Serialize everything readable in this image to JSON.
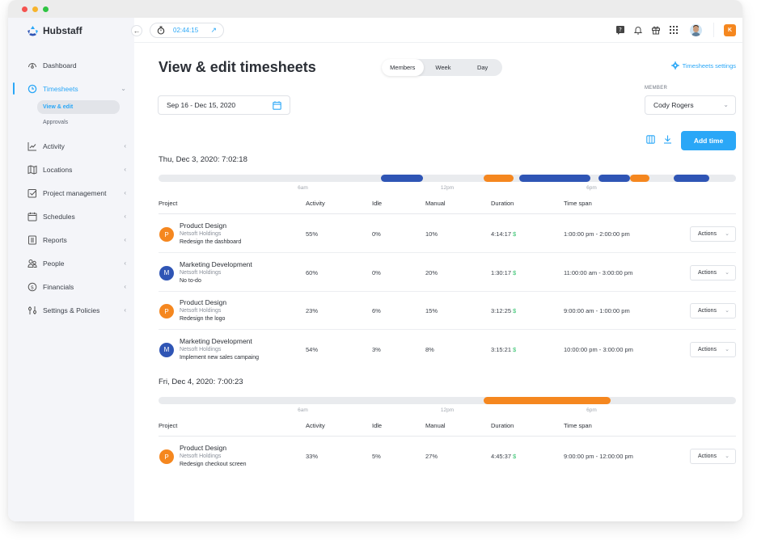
{
  "app": {
    "name": "Hubstaff",
    "timer": "02:44:15",
    "org_badge": "K"
  },
  "sidebar": {
    "items": [
      {
        "label": "Dashboard",
        "icon": "dashboard-icon"
      },
      {
        "label": "Timesheets",
        "icon": "clock-icon",
        "active": true,
        "expanded": true,
        "children": [
          {
            "label": "View & edit",
            "active": true
          },
          {
            "label": "Approvals"
          }
        ]
      },
      {
        "label": "Activity",
        "icon": "chart-icon"
      },
      {
        "label": "Locations",
        "icon": "map-icon"
      },
      {
        "label": "Project management",
        "icon": "checkbox-icon"
      },
      {
        "label": "Schedules",
        "icon": "calendar-icon"
      },
      {
        "label": "Reports",
        "icon": "report-icon"
      },
      {
        "label": "People",
        "icon": "people-icon"
      },
      {
        "label": "Financials",
        "icon": "dollar-icon"
      },
      {
        "label": "Settings & Policies",
        "icon": "sliders-icon"
      }
    ]
  },
  "header": {
    "title": "View & edit timesheets",
    "view_tabs": [
      {
        "label": "Members",
        "active": true
      },
      {
        "label": "Week"
      },
      {
        "label": "Day"
      }
    ],
    "settings_link": "Timesheets settings",
    "date_range": "Sep 16 - Dec 15, 2020",
    "member_label": "MEMBER",
    "member_value": "Cody Rogers",
    "add_time_label": "Add time"
  },
  "columns": [
    "Project",
    "Activity",
    "Idle",
    "Manual",
    "Duration",
    "Time span"
  ],
  "colors": {
    "accent": "#2aa7f7",
    "blue_segment": "#2f55b5",
    "orange_segment": "#f5871f",
    "money": "#31c26c"
  },
  "days": [
    {
      "title": "Thu, Dec 3, 2020:  7:02:18",
      "ticks": [
        "6am",
        "12pm",
        "6pm"
      ],
      "timeline_hours": [
        0,
        24
      ],
      "segments": [
        {
          "start": 9.25,
          "end": 11.0,
          "type": "blue"
        },
        {
          "start": 13.5,
          "end": 14.75,
          "type": "orange"
        },
        {
          "start": 15.0,
          "end": 17.95,
          "type": "blue"
        },
        {
          "start": 18.3,
          "end": 19.6,
          "type": "blue"
        },
        {
          "start": 19.6,
          "end": 20.4,
          "type": "orange"
        },
        {
          "start": 21.4,
          "end": 22.9,
          "type": "blue"
        }
      ],
      "rows": [
        {
          "initial": "P",
          "color": "orange",
          "project": "Product Design",
          "org": "Netsoft Holdings",
          "task": "Redesign the dashboard",
          "activity": "55%",
          "idle": "0%",
          "manual": "10%",
          "duration": "4:14:17",
          "money": "$",
          "span": "1:00:00 pm - 2:00:00 pm",
          "action": "Actions"
        },
        {
          "initial": "M",
          "color": "blue",
          "project": "Marketing Development",
          "org": "Netsoft Holdings",
          "task": "No to-do",
          "activity": "60%",
          "idle": "0%",
          "manual": "20%",
          "duration": "1:30:17",
          "money": "$",
          "span": "11:00:00 am - 3:00:00 pm",
          "action": "Actions"
        },
        {
          "initial": "P",
          "color": "orange",
          "project": "Product Design",
          "org": "Netsoft Holdings",
          "task": "Redesign the logo",
          "activity": "23%",
          "idle": "6%",
          "manual": "15%",
          "duration": "3:12:25",
          "money": "$",
          "span": "9:00:00 am - 1:00:00 pm",
          "action": "Actions"
        },
        {
          "initial": "M",
          "color": "blue",
          "project": "Marketing Development",
          "org": "Netsoft Holdings",
          "task": "Implement new sales campaing",
          "activity": "54%",
          "idle": "3%",
          "manual": "8%",
          "duration": "3:15:21",
          "money": "$",
          "span": "10:00:00 pm - 3:00:00 pm",
          "action": "Actions"
        }
      ]
    },
    {
      "title": "Fri, Dec 4, 2020:  7:00:23",
      "ticks": [
        "6am",
        "12pm",
        "6pm"
      ],
      "timeline_hours": [
        0,
        24
      ],
      "segments": [
        {
          "start": 13.5,
          "end": 18.8,
          "type": "orange"
        }
      ],
      "rows": [
        {
          "initial": "P",
          "color": "orange",
          "project": "Product Design",
          "org": "Netsoft Holdings",
          "task": "Redesign checkout screen",
          "activity": "33%",
          "idle": "5%",
          "manual": "27%",
          "duration": "4:45:37",
          "money": "$",
          "span": "9:00:00 pm - 12:00:00 pm",
          "action": "Actions"
        }
      ]
    }
  ]
}
